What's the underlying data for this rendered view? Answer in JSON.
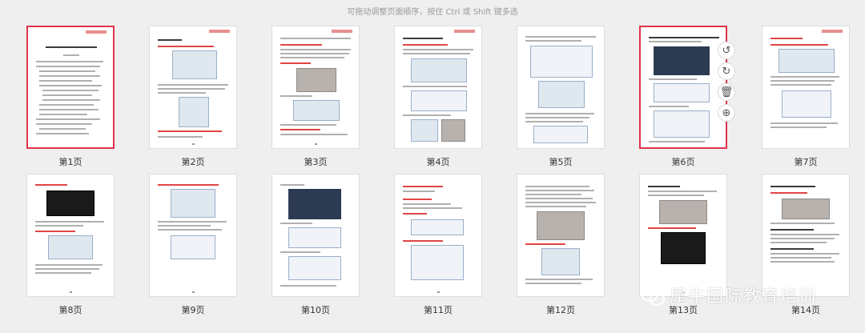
{
  "hint": "可拖动调整页面顺序，按住 Ctrl 或 Shift 键多选",
  "pages": [
    {
      "label": "第1页",
      "selected": true
    },
    {
      "label": "第2页"
    },
    {
      "label": "第3页"
    },
    {
      "label": "第4页"
    },
    {
      "label": "第5页"
    },
    {
      "label": "第6页",
      "selected": true
    },
    {
      "label": "第7页"
    },
    {
      "label": "第8页"
    },
    {
      "label": "第9页"
    },
    {
      "label": "第10页"
    },
    {
      "label": "第11页"
    },
    {
      "label": "第12页"
    },
    {
      "label": "第13页"
    },
    {
      "label": "第14页"
    }
  ],
  "tools": [
    {
      "name": "rotate-left-icon",
      "glyph": "↺"
    },
    {
      "name": "rotate-right-icon",
      "glyph": "↻"
    },
    {
      "name": "delete-icon",
      "glyph": "🗑"
    },
    {
      "name": "add-icon",
      "glyph": "⊕"
    }
  ],
  "watermark": "犀牛国际教育培训",
  "colors": {
    "selected_border": "#e0324b",
    "background": "#efefef"
  }
}
